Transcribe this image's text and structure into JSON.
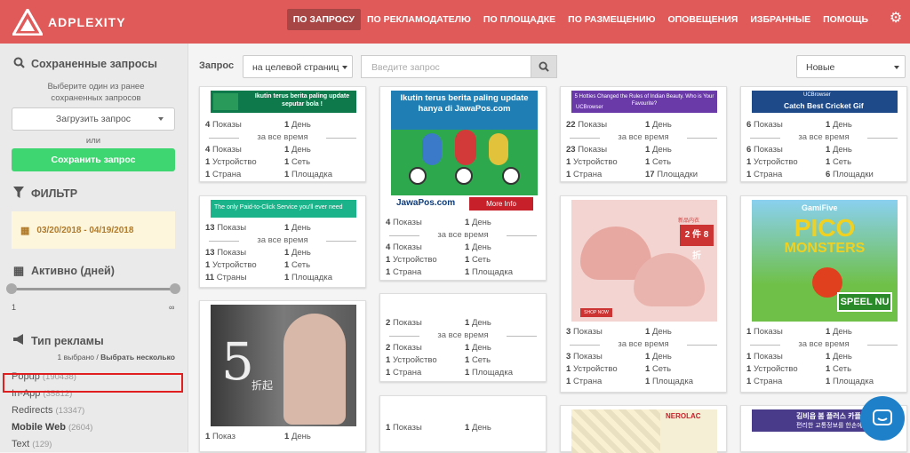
{
  "brand": {
    "name": "ADPLEXITY"
  },
  "nav": [
    "ПО ЗАПРОСУ",
    "ПО РЕКЛАМОДАТЕЛЮ",
    "ПО ПЛОЩАДКЕ",
    "ПО РАЗМЕЩЕНИЮ",
    "ОПОВЕЩЕНИЯ",
    "ИЗБРАННЫЕ",
    "ПОМОЩЬ"
  ],
  "sidebar": {
    "saved_title": "Сохраненные запросы",
    "saved_note": "Выберите один из ранее сохраненных запросов",
    "load_btn": "Загрузить запрос",
    "or": "или",
    "save_btn": "Сохранить запрос",
    "filter_title": "ФИЛЬТР",
    "date_range": "03/20/2018 - 04/19/2018",
    "active_title": "Активно (дней)",
    "slider_min": "1",
    "slider_max": "∞",
    "adtype_title": "Тип рекламы",
    "adtype_sel_count": "1 выбрано",
    "adtype_sel_sep": " / ",
    "adtype_sel_multi": "Выбрать несколько",
    "adtypes": [
      {
        "name": "Popup",
        "count": "(190438)"
      },
      {
        "name": "In-App",
        "count": "(35812)"
      },
      {
        "name": "Redirects",
        "count": "(13347)"
      },
      {
        "name": "Mobile Web",
        "count": "(2604)"
      },
      {
        "name": "Text",
        "count": "(129)"
      }
    ]
  },
  "query": {
    "label": "Запрос",
    "scope": "на целевой страниц",
    "placeholder": "Введите запрос"
  },
  "sort": {
    "value": "Новые"
  },
  "labels": {
    "shows": "Показы",
    "shows_one": "Показ",
    "day": "День",
    "alltime": "за все время",
    "device": "Устройство",
    "net": "Сеть",
    "country": "Страна",
    "countries": "Страны",
    "site": "Площадка",
    "sites": "Площадки"
  },
  "banners": {
    "b1": "Ikutin terus berita paling update seputar bola !",
    "b2": "Ikutin terus berita paling update hanya di JawaPos.com",
    "b2_logo": "JawaPos.com",
    "b2_more": "More Info",
    "b3": "The only Paid-to-Click Service you'll ever need",
    "b5": "5 Hotties Changed the Rules of Indian Beauty. Who is Your Favourite?",
    "b5_brand": "UCBrowser",
    "b6": "Catch Best Cricket Gif",
    "b6_brand": "UCBrowser",
    "b8_cn": "2 件 8 折",
    "b8_shop": "SHOP NOW",
    "b8_cn_top": "新品内衣",
    "b9_brand": "GamiFive",
    "b9_title1": "PICO",
    "b9_title2": "MONSTERS",
    "b9_play": "SPEEL NU",
    "b10_num": "5",
    "b10_cn": "折起",
    "b12_brand": "NEROLAC",
    "b13_text": "김비읍 봄 플러스 카플",
    "b13_text2": "편리한 교통정보를 한손에"
  },
  "cards": [
    {
      "id": "c1",
      "s": [
        [
          "4",
          "1"
        ],
        [
          "4",
          "1"
        ],
        [
          "1",
          "1"
        ],
        [
          "1",
          "1"
        ]
      ],
      "t": [
        "shows",
        "day",
        "shows",
        "day",
        "device",
        "net",
        "country",
        "site"
      ]
    },
    {
      "id": "c2",
      "s": [
        [
          "4",
          "1"
        ],
        [
          "4",
          "1"
        ],
        [
          "1",
          "1"
        ],
        [
          "1",
          "1"
        ]
      ],
      "t": [
        "shows",
        "day",
        "shows",
        "day",
        "device",
        "net",
        "country",
        "site"
      ]
    },
    {
      "id": "c3",
      "s": [
        [
          "22",
          "1"
        ],
        [
          "23",
          "1"
        ],
        [
          "1",
          "1"
        ],
        [
          "1",
          "17"
        ]
      ],
      "t": [
        "shows",
        "day",
        "shows",
        "day",
        "device",
        "net",
        "country",
        "sites"
      ]
    },
    {
      "id": "c4",
      "s": [
        [
          "6",
          "1"
        ],
        [
          "6",
          "1"
        ],
        [
          "1",
          "1"
        ],
        [
          "1",
          "6"
        ]
      ],
      "t": [
        "shows",
        "day",
        "shows",
        "day",
        "device",
        "net",
        "country",
        "sites"
      ]
    },
    {
      "id": "c5",
      "s": [
        [
          "13",
          "1"
        ],
        [
          "13",
          "1"
        ],
        [
          "1",
          "1"
        ],
        [
          "11",
          "1"
        ]
      ],
      "t": [
        "shows",
        "day",
        "shows",
        "day",
        "device",
        "net",
        "countries",
        "site"
      ]
    },
    {
      "id": "c6",
      "s": [
        [
          "2",
          "1"
        ],
        [
          "2",
          "1"
        ],
        [
          "1",
          "1"
        ],
        [
          "1",
          "1"
        ]
      ],
      "t": [
        "shows",
        "day",
        "shows",
        "day",
        "device",
        "net",
        "country",
        "site"
      ]
    },
    {
      "id": "c7",
      "s": [
        [
          "3",
          "1"
        ],
        [
          "3",
          "1"
        ],
        [
          "1",
          "1"
        ],
        [
          "1",
          "1"
        ]
      ],
      "t": [
        "shows",
        "day",
        "shows",
        "day",
        "device",
        "net",
        "country",
        "site"
      ]
    },
    {
      "id": "c8",
      "s": [
        [
          "1",
          "1"
        ],
        [
          "1",
          "1"
        ],
        [
          "1",
          "1"
        ],
        [
          "1",
          "1"
        ]
      ],
      "t": [
        "shows",
        "day",
        "shows",
        "day",
        "device",
        "net",
        "country",
        "site"
      ]
    },
    {
      "id": "c9",
      "s": [
        [
          "1",
          "1"
        ]
      ],
      "t": [
        "shows_one",
        "day"
      ]
    },
    {
      "id": "c10",
      "s": [
        [
          "1",
          "1"
        ]
      ],
      "t": [
        "shows",
        "day"
      ]
    }
  ],
  "colors": {
    "brand": "#e05a5a",
    "nav_active": "#a84545",
    "save": "#3dd670",
    "highlight": "#e02020",
    "chat": "#1e80c8"
  }
}
